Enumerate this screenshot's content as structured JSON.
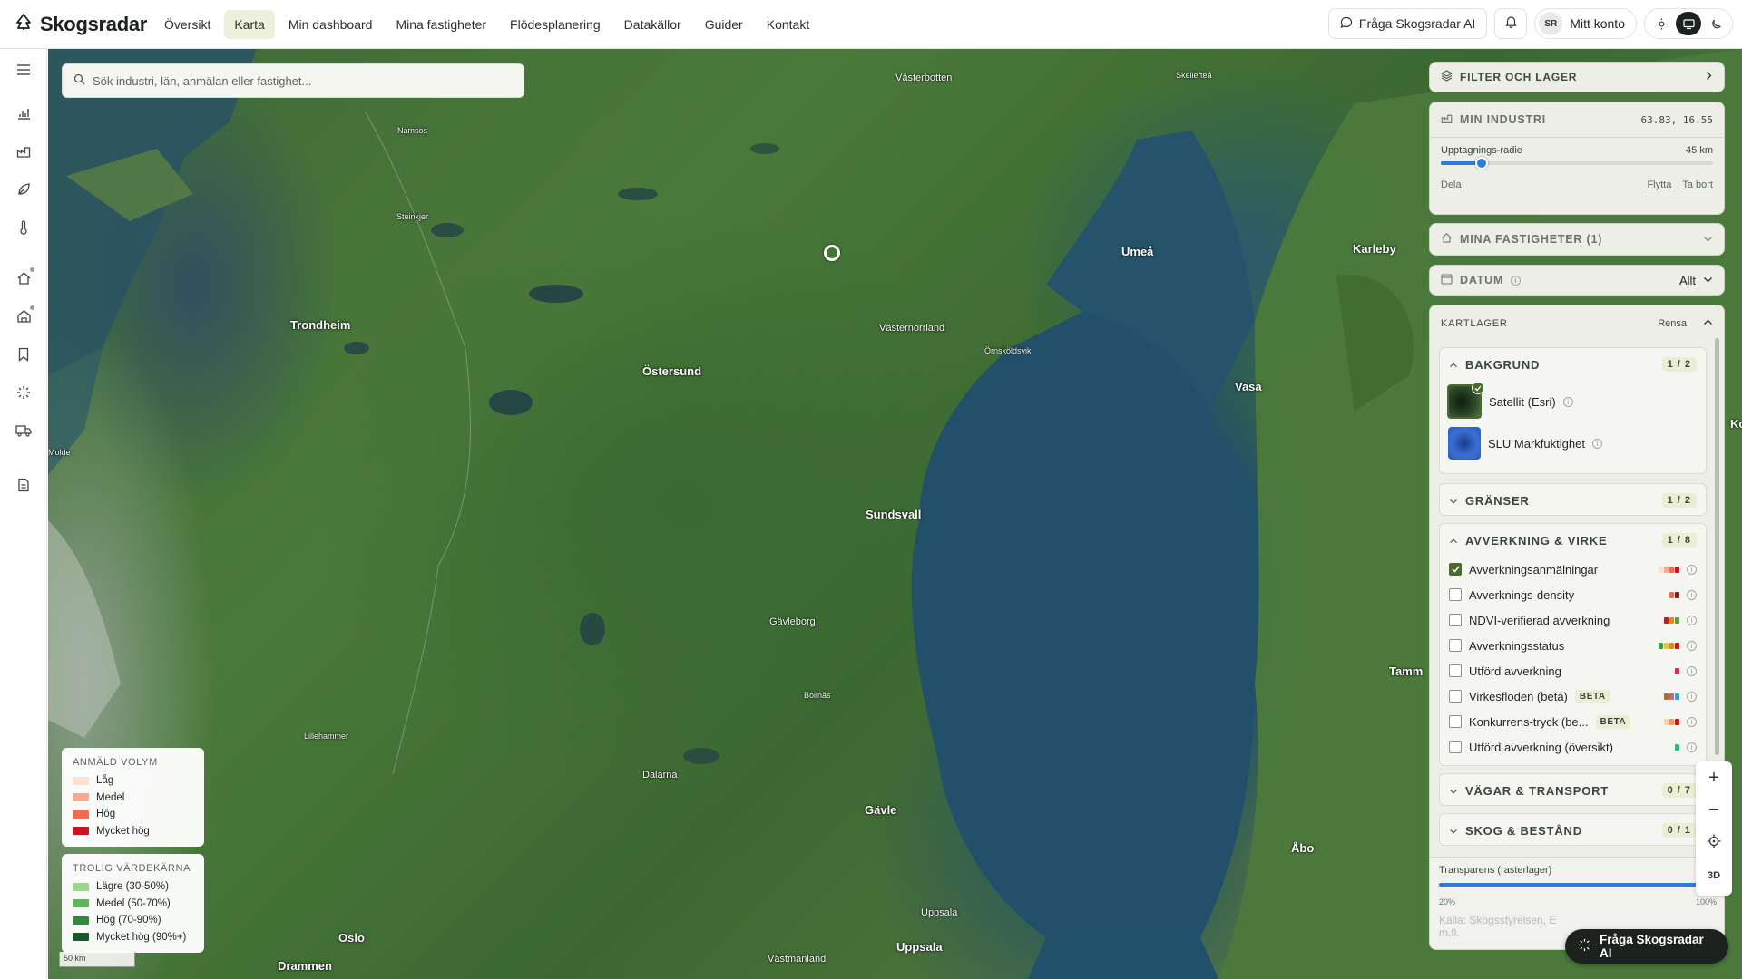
{
  "app": {
    "name": "Skogsradar"
  },
  "nav": {
    "items": [
      "Översikt",
      "Karta",
      "Min dashboard",
      "Mina fastigheter",
      "Flödesplanering",
      "Datakällor",
      "Guider",
      "Kontakt"
    ],
    "active": "Karta"
  },
  "header": {
    "ask_label": "Fråga Skogsradar AI",
    "account_initials": "SR",
    "account_label": "Mitt konto"
  },
  "search": {
    "placeholder": "Sök industri, län, anmälan eller fastighet..."
  },
  "map": {
    "places": [
      {
        "name": "Västerbotten",
        "cls": "mid"
      },
      {
        "name": "Skellefteå",
        "cls": "small"
      },
      {
        "name": "Namsos",
        "cls": "small"
      },
      {
        "name": "Steinkjer",
        "cls": "small"
      },
      {
        "name": "Umeå",
        "cls": "big"
      },
      {
        "name": "Karleby",
        "cls": "big"
      },
      {
        "name": "Trondheim",
        "cls": "big"
      },
      {
        "name": "Västernorrland",
        "cls": "mid"
      },
      {
        "name": "Örnsköldsvik",
        "cls": "small"
      },
      {
        "name": "Östersund",
        "cls": "big"
      },
      {
        "name": "Vasa",
        "cls": "big"
      },
      {
        "name": "Molde",
        "cls": "small"
      },
      {
        "name": "Sundsvall",
        "cls": "big"
      },
      {
        "name": "Gävleborg",
        "cls": "mid"
      },
      {
        "name": "Tamm",
        "cls": "big"
      },
      {
        "name": "Bollnäs",
        "cls": "small"
      },
      {
        "name": "Lillehammer",
        "cls": "small"
      },
      {
        "name": "Dalarna",
        "cls": "mid"
      },
      {
        "name": "Gävle",
        "cls": "big"
      },
      {
        "name": "Åbo",
        "cls": "big"
      },
      {
        "name": "Uppsala",
        "cls": "mid"
      },
      {
        "name": "Uppsala",
        "cls": "big"
      },
      {
        "name": "Oslo",
        "cls": "big"
      },
      {
        "name": "Drammen",
        "cls": "big"
      },
      {
        "name": "Västmanland",
        "cls": "mid"
      },
      {
        "name": "Ko",
        "cls": "big"
      }
    ]
  },
  "legend_volume": {
    "title": "ANMÄLD VOLYM",
    "items": [
      {
        "label": "Låg",
        "color": "#fde0d2"
      },
      {
        "label": "Medel",
        "color": "#f9a98d"
      },
      {
        "label": "Hög",
        "color": "#f26a4f"
      },
      {
        "label": "Mycket hög",
        "color": "#c8161e"
      }
    ]
  },
  "legend_value": {
    "title": "TROLIG VÄRDEKÄRNA",
    "items": [
      {
        "label": "Lägre (30-50%)",
        "color": "#9fd48c"
      },
      {
        "label": "Medel (50-70%)",
        "color": "#62b45a"
      },
      {
        "label": "Hög (70-90%)",
        "color": "#2f8a3c"
      },
      {
        "label": "Mycket hög (90%+)",
        "color": "#145a2a"
      }
    ]
  },
  "scale_label": "50 km",
  "panel": {
    "filter": {
      "title": "FILTER OCH LAGER"
    },
    "industry": {
      "title": "MIN INDUSTRI",
      "coords": "63.83, 16.55",
      "radius_label": "Upptagnings-radie",
      "radius_value": "45 km",
      "radius_fraction": 0.15,
      "share": "Dela",
      "move": "Flytta",
      "remove": "Ta bort"
    },
    "properties": {
      "title": "MINA FASTIGHETER (1)"
    },
    "date": {
      "title": "DATUM",
      "value": "Allt"
    },
    "layers": {
      "title": "KARTLAGER",
      "clear": "Rensa",
      "groups": {
        "background": {
          "title": "BAKGRUND",
          "count": "1 / 2",
          "items": [
            "Satellit (Esri)",
            "SLU Markfuktighet"
          ]
        },
        "borders": {
          "title": "GRÄNSER",
          "count": "1 / 2"
        },
        "harvest": {
          "title": "AVVERKNING & VIRKE",
          "count": "1 / 8",
          "items": [
            {
              "label": "Avverkningsanmälningar",
              "checked": true,
              "colors": [
                "#fde0d2",
                "#f9a98d",
                "#f26a4f",
                "#c8161e"
              ]
            },
            {
              "label": "Avverknings-density",
              "checked": false,
              "colors": [
                "#f26a4f",
                "#8b1a1a"
              ]
            },
            {
              "label": "NDVI-verifierad avverkning",
              "checked": false,
              "colors": [
                "#c8161e",
                "#e38a1c",
                "#5a9c3c"
              ]
            },
            {
              "label": "Avverkningsstatus",
              "checked": false,
              "colors": [
                "#3aa14a",
                "#f0c22b",
                "#e38a1c",
                "#c8161e"
              ]
            },
            {
              "label": "Utförd avverkning",
              "checked": false,
              "colors": [
                "#d6286e"
              ]
            },
            {
              "label": "Virkesflöden (beta)",
              "checked": false,
              "beta": "BETA",
              "colors": [
                "#b06a2a",
                "#c26b7a",
                "#2aa8c6"
              ]
            },
            {
              "label": "Konkurrens-tryck (be...",
              "checked": false,
              "beta": "BETA",
              "colors": [
                "#f8d2b4",
                "#f29a5a",
                "#c8161e"
              ]
            },
            {
              "label": "Utförd avverkning (översikt)",
              "checked": false,
              "colors": [
                "#22c47a"
              ]
            }
          ]
        },
        "roads": {
          "title": "VÄGAR & TRANSPORT",
          "count": "0 / 7"
        },
        "forest": {
          "title": "SKOG & BESTÅND",
          "count": "0 / 1"
        }
      },
      "opacity": {
        "label": "Transparens (rasterlager)",
        "value": "10",
        "min": "20%",
        "max": "100%",
        "fraction": 1.0
      },
      "source": "Källa: Skogsstyrelsen, E",
      "source2": "m.fl."
    }
  },
  "zoom": {
    "plus": "+",
    "minus": "−",
    "locate": "locate-icon",
    "mode": "3D"
  },
  "ai_button": {
    "label": "Fråga Skogsradar AI"
  }
}
